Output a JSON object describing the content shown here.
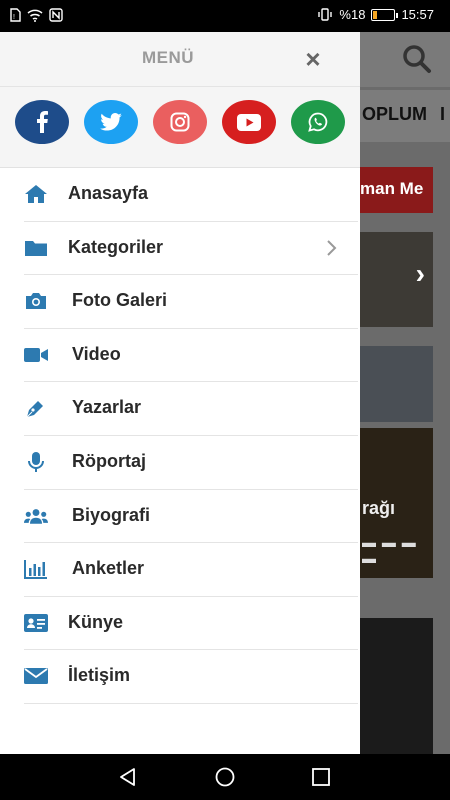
{
  "status_bar": {
    "battery_text": "%18",
    "time": "15:57",
    "battery_level": 0.18
  },
  "background": {
    "nav_label": "OPLUM",
    "nav_label2": "I",
    "red_banner": "man Me",
    "card_text": "rağı"
  },
  "drawer": {
    "title": "MENÜ",
    "close_glyph": "×",
    "social": [
      {
        "name": "facebook",
        "color": "#1e4c8a"
      },
      {
        "name": "twitter",
        "color": "#1da1f2"
      },
      {
        "name": "instagram",
        "color": "#ea5f5f"
      },
      {
        "name": "youtube",
        "color": "#d61f1f"
      },
      {
        "name": "whatsapp",
        "color": "#1f9a4a"
      }
    ],
    "items": [
      {
        "label": "Anasayfa",
        "icon": "home-icon"
      },
      {
        "label": "Kategoriler",
        "icon": "folder-icon"
      },
      {
        "label": "Foto Galeri",
        "icon": "camera-icon"
      },
      {
        "label": "Video",
        "icon": "video-icon"
      },
      {
        "label": "Yazarlar",
        "icon": "pen-icon"
      },
      {
        "label": "Röportaj",
        "icon": "microphone-icon"
      },
      {
        "label": "Biyografi",
        "icon": "users-icon"
      },
      {
        "label": "Anketler",
        "icon": "poll-chart-icon"
      },
      {
        "label": "Künye",
        "icon": "id-card-icon"
      },
      {
        "label": "İletişim",
        "icon": "envelope-icon"
      }
    ]
  },
  "colors": {
    "accent_icon": "#2d7ab0",
    "text": "#2a2a2a"
  }
}
